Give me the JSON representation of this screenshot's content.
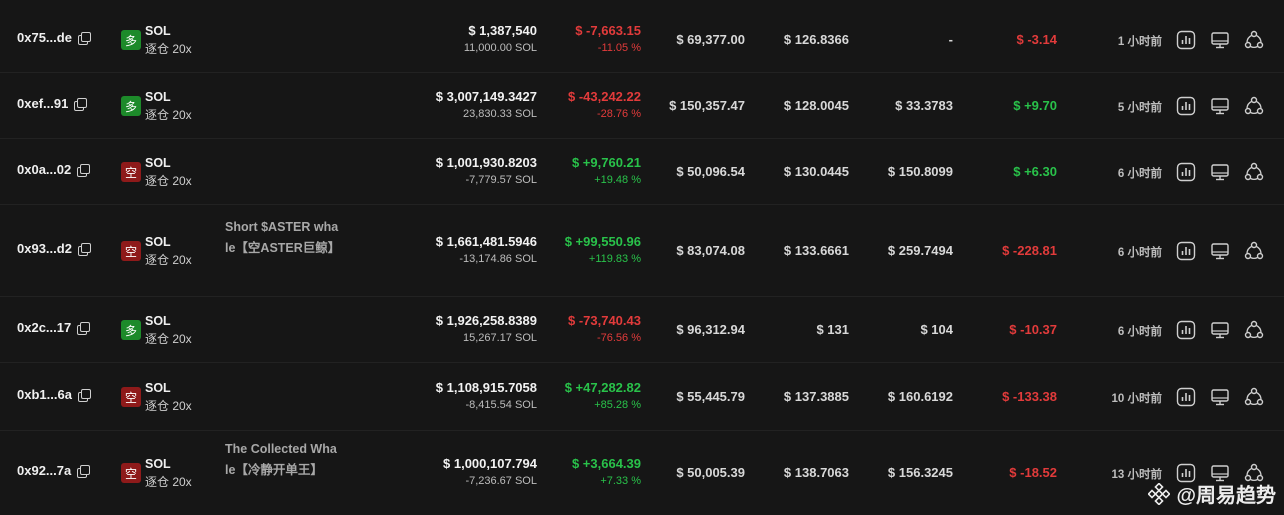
{
  "rows": [
    {
      "address": "0x75...de",
      "side": "long",
      "side_label": "多",
      "symbol": "SOL",
      "mode": "逐仓 20x",
      "label": "",
      "value": "$ 1,387,540",
      "size": "11,000.00 SOL",
      "pnl": "$ -7,663.15",
      "pnl_pct": "-11.05 %",
      "pnl_sign": "neg",
      "margin": "$ 69,377.00",
      "entry": "$ 126.8366",
      "liq": "-",
      "funding": "$ -3.14",
      "funding_sign": "neg",
      "time": "1 小时前"
    },
    {
      "address": "0xef...91",
      "side": "long",
      "side_label": "多",
      "symbol": "SOL",
      "mode": "逐仓 20x",
      "label": "",
      "value": "$ 3,007,149.3427",
      "size": "23,830.33 SOL",
      "pnl": "$ -43,242.22",
      "pnl_pct": "-28.76 %",
      "pnl_sign": "neg",
      "margin": "$ 150,357.47",
      "entry": "$ 128.0045",
      "liq": "$ 33.3783",
      "funding": "$ +9.70",
      "funding_sign": "pos",
      "time": "5 小时前"
    },
    {
      "address": "0x0a...02",
      "side": "short",
      "side_label": "空",
      "symbol": "SOL",
      "mode": "逐仓 20x",
      "label": "",
      "value": "$ 1,001,930.8203",
      "size": "-7,779.57 SOL",
      "pnl": "$ +9,760.21",
      "pnl_pct": "+19.48 %",
      "pnl_sign": "pos",
      "margin": "$ 50,096.54",
      "entry": "$ 130.0445",
      "liq": "$ 150.8099",
      "funding": "$ +6.30",
      "funding_sign": "pos",
      "time": "6 小时前"
    },
    {
      "address": "0x93...d2",
      "side": "short",
      "side_label": "空",
      "symbol": "SOL",
      "mode": "逐仓 20x",
      "label": "Short $ASTER whale【空ASTER巨鲸】",
      "value": "$ 1,661,481.5946",
      "size": "-13,174.86 SOL",
      "pnl": "$ +99,550.96",
      "pnl_pct": "+119.83 %",
      "pnl_sign": "pos",
      "margin": "$ 83,074.08",
      "entry": "$ 133.6661",
      "liq": "$ 259.7494",
      "funding": "$ -228.81",
      "funding_sign": "neg",
      "time": "6 小时前"
    },
    {
      "address": "0x2c...17",
      "side": "long",
      "side_label": "多",
      "symbol": "SOL",
      "mode": "逐仓 20x",
      "label": "",
      "value": "$ 1,926,258.8389",
      "size": "15,267.17 SOL",
      "pnl": "$ -73,740.43",
      "pnl_pct": "-76.56 %",
      "pnl_sign": "neg",
      "margin": "$ 96,312.94",
      "entry": "$ 131",
      "liq": "$ 104",
      "funding": "$ -10.37",
      "funding_sign": "neg",
      "time": "6 小时前"
    },
    {
      "address": "0xb1...6a",
      "side": "short",
      "side_label": "空",
      "symbol": "SOL",
      "mode": "逐仓 20x",
      "label": "",
      "value": "$ 1,108,915.7058",
      "size": "-8,415.54 SOL",
      "pnl": "$ +47,282.82",
      "pnl_pct": "+85.28 %",
      "pnl_sign": "pos",
      "margin": "$ 55,445.79",
      "entry": "$ 137.3885",
      "liq": "$ 160.6192",
      "funding": "$ -133.38",
      "funding_sign": "neg",
      "time": "10 小时前"
    },
    {
      "address": "0x92...7a",
      "side": "short",
      "side_label": "空",
      "symbol": "SOL",
      "mode": "逐仓 20x",
      "label": "The Collected Whale【冷静开单王】",
      "value": "$ 1,000,107.794",
      "size": "-7,236.67 SOL",
      "pnl": "$ +3,664.39",
      "pnl_pct": "+7.33 %",
      "pnl_sign": "pos",
      "margin": "$ 50,005.39",
      "entry": "$ 138.7063",
      "liq": "$ 156.3245",
      "funding": "$ -18.52",
      "funding_sign": "neg",
      "time": "13 小时前"
    }
  ],
  "watermark": {
    "text": "@周易趋势"
  },
  "colors": {
    "positive": "#29c24a",
    "negative": "#e23b3b",
    "long_badge": "#1d8a2a",
    "short_badge": "#8e1a1a"
  },
  "icons": [
    "copy-icon",
    "chart-icon",
    "monitor-icon",
    "share-icon"
  ]
}
